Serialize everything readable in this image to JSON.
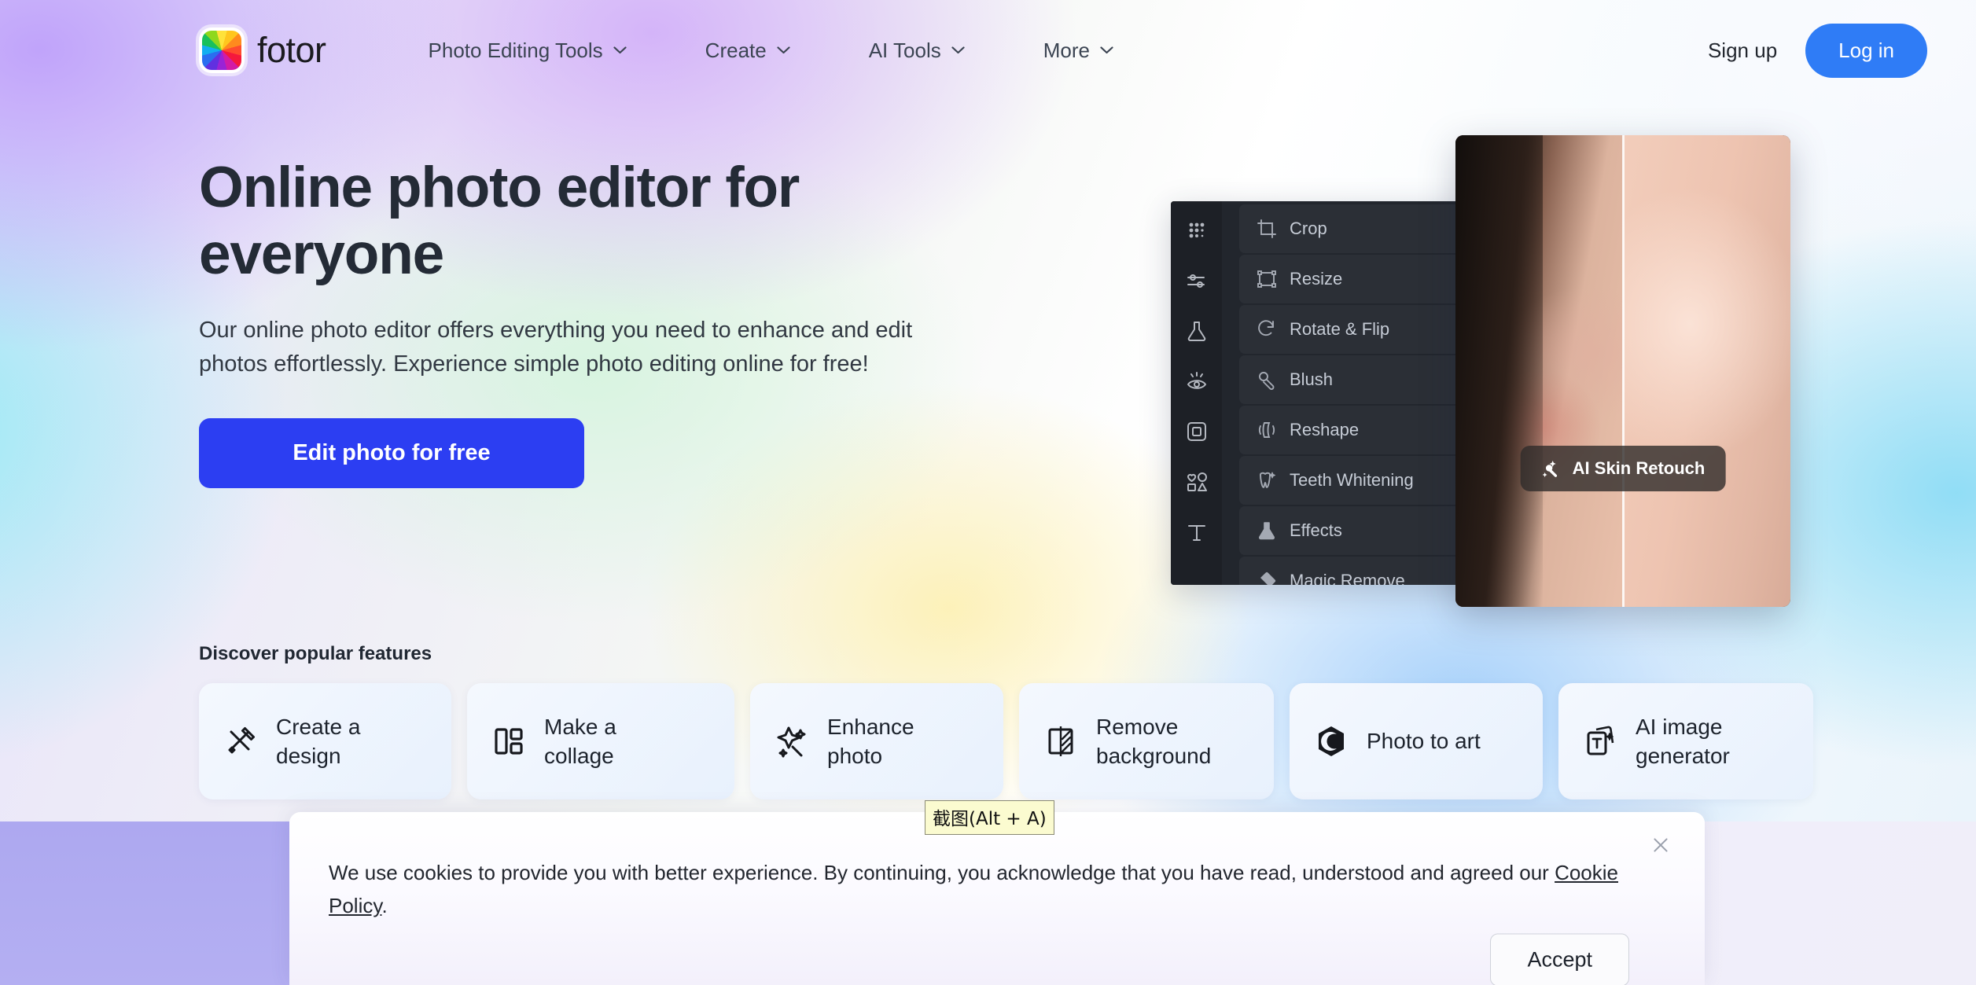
{
  "brand": {
    "name": "fotor",
    "logo_icon": "fotor-color-wheel-icon"
  },
  "header": {
    "nav": [
      {
        "label": "Photo Editing Tools",
        "icon": "chevron-down-icon"
      },
      {
        "label": "Create",
        "icon": "chevron-down-icon"
      },
      {
        "label": "AI Tools",
        "icon": "chevron-down-icon"
      },
      {
        "label": "More",
        "icon": "chevron-down-icon"
      }
    ],
    "signup_label": "Sign up",
    "login_label": "Log in",
    "login_color": "#2f7cf6"
  },
  "hero": {
    "title": "Online photo editor for everyone",
    "subtitle": "Our online photo editor offers everything you need to enhance and edit photos effortlessly. Experience simple photo editing online for free!",
    "cta_label": "Edit photo for free",
    "cta_color": "#2c3ef2"
  },
  "features": {
    "title": "Discover popular features",
    "cards": [
      {
        "label": "Create a\ndesign",
        "icon": "pencil-ruler-icon"
      },
      {
        "label": "Make a\ncollage",
        "icon": "collage-grid-icon"
      },
      {
        "label": "Enhance\nphoto",
        "icon": "magic-sparkle-icon"
      },
      {
        "label": "Remove\nbackground",
        "icon": "remove-background-icon"
      },
      {
        "label": "Photo to art",
        "icon": "photo-to-art-icon"
      },
      {
        "label": "AI image\ngenerator",
        "icon": "ai-image-generator-icon"
      }
    ]
  },
  "editor": {
    "rail_icons": [
      "apps-grid-icon",
      "adjust-sliders-icon",
      "flask-effects-icon",
      "beauty-eye-icon",
      "frame-icon",
      "shapes-icon",
      "text-icon"
    ],
    "tools": [
      {
        "label": "Crop",
        "icon": "crop-icon"
      },
      {
        "label": "Resize",
        "icon": "resize-icon"
      },
      {
        "label": "Rotate & Flip",
        "icon": "rotate-flip-icon"
      },
      {
        "label": "Blush",
        "icon": "blush-icon"
      },
      {
        "label": "Reshape",
        "icon": "reshape-icon"
      },
      {
        "label": "Teeth Whitening",
        "icon": "teeth-whitening-icon"
      },
      {
        "label": "Effects",
        "icon": "effects-icon"
      },
      {
        "label": "Magic Remove",
        "icon": "magic-remove-icon"
      }
    ],
    "photo_badge": {
      "label": "AI Skin Retouch",
      "icon": "ai-skin-retouch-icon"
    }
  },
  "cookie": {
    "text_before_link": "We use cookies to provide you with better experience. By continuing, you acknowledge that you have read, understood and agreed our ",
    "link_label": "Cookie Policy",
    "text_after_link": ".",
    "accept_label": "Accept",
    "close_icon": "close-icon"
  },
  "tooltip": {
    "label": "截图(Alt + A)"
  }
}
